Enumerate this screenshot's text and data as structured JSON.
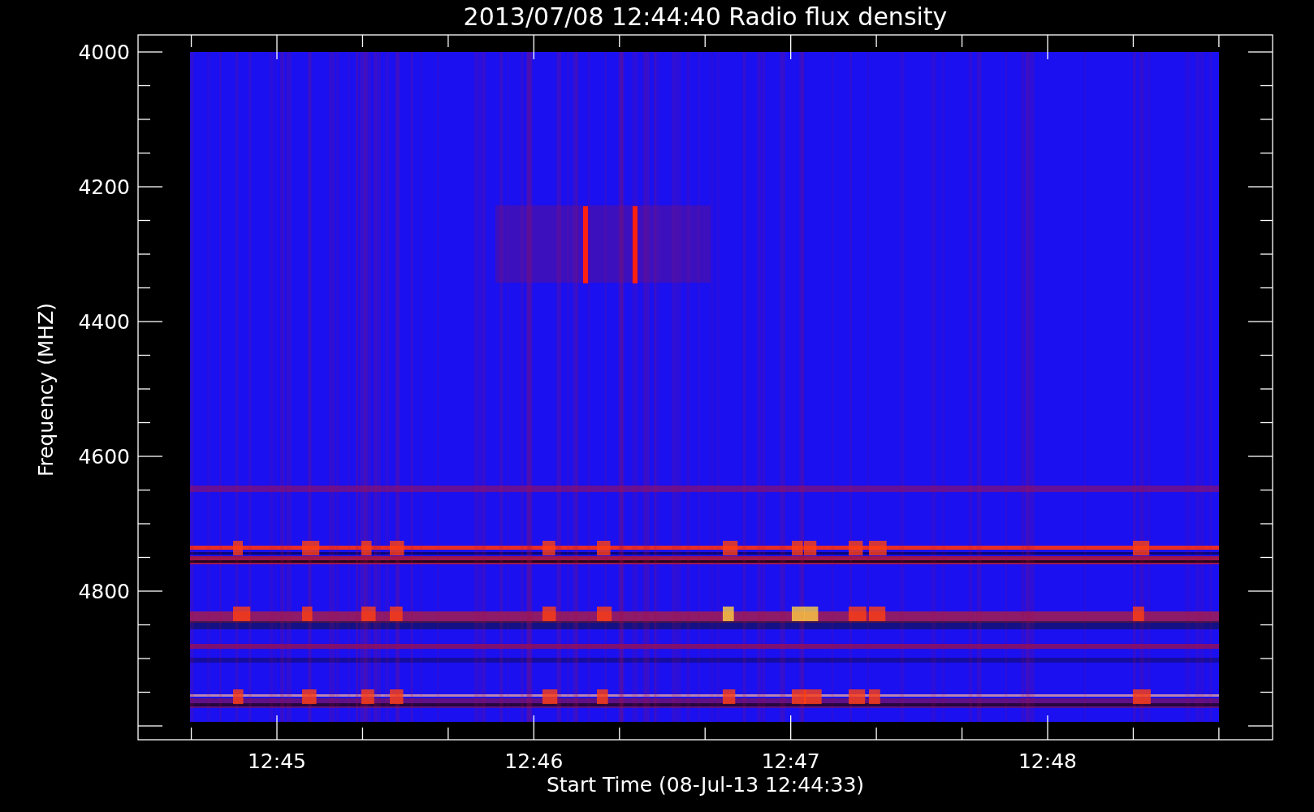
{
  "title": "2013/07/08 12:44:40 Radio flux density",
  "ylabel": "Frequency (MHZ)",
  "xlabel": "Start Time (08-Jul-13 12:44:33)",
  "yticks": [
    "4000",
    "4200",
    "4400",
    "4600",
    "4800"
  ],
  "xticks": [
    "12:45",
    "12:46",
    "12:47",
    "12:48"
  ]
}
